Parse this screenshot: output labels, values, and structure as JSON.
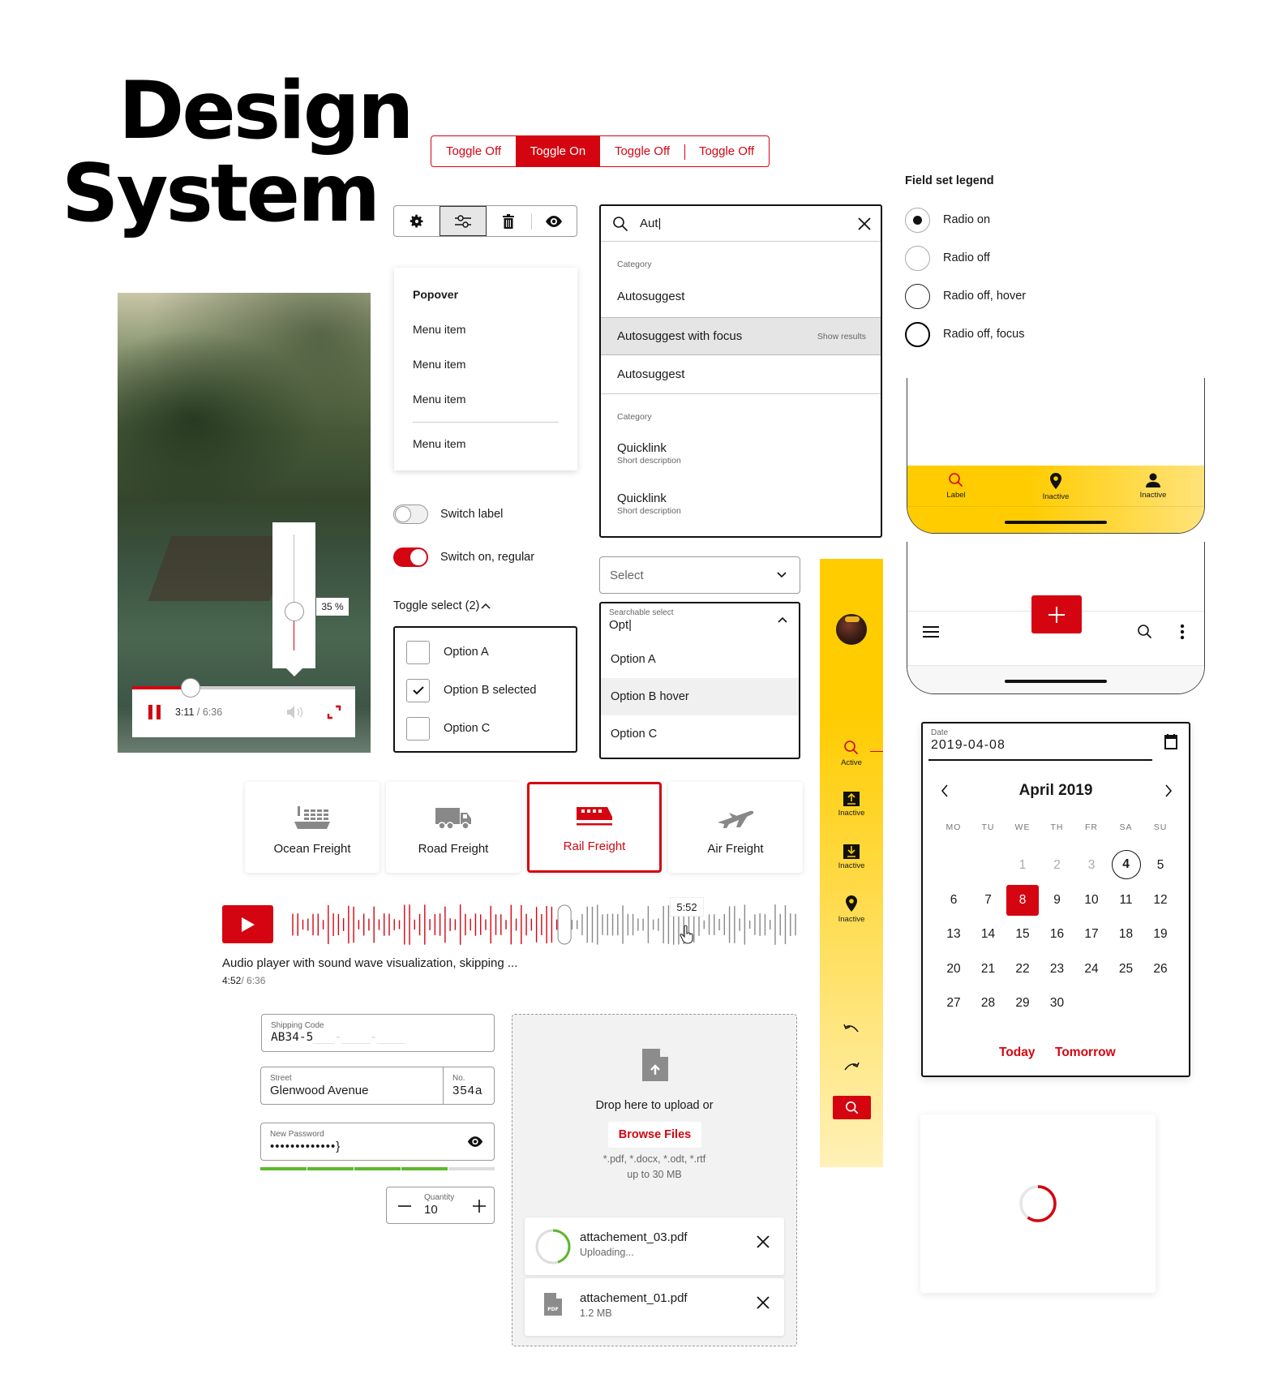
{
  "title": {
    "line1": "Design",
    "line2": "System"
  },
  "toggle_group": [
    {
      "label": "Toggle Off",
      "on": false
    },
    {
      "label": "Toggle On",
      "on": true
    },
    {
      "label": "Toggle Off",
      "on": false
    },
    {
      "label": "Toggle Off",
      "on": false
    }
  ],
  "icon_toolbar": [
    "gear-icon",
    "sliders-icon",
    "trash-icon",
    "eye-icon"
  ],
  "popover": {
    "heading": "Popover",
    "items": [
      "Menu item",
      "Menu item",
      "Menu item",
      "Menu item"
    ]
  },
  "autosuggest": {
    "query": "Aut|",
    "category1": "Category",
    "item1": "Autosuggest",
    "item_focus": "Autosuggest with focus",
    "show_results": "Show results",
    "item3": "Autosuggest",
    "category2": "Category",
    "quicklink1": {
      "title": "Quicklink",
      "desc": "Short description"
    },
    "quicklink2": {
      "title": "Quicklink",
      "desc": "Short description"
    }
  },
  "fieldset": {
    "legend": "Field set legend",
    "radios": [
      {
        "label": "Radio on",
        "checked": true
      },
      {
        "label": "Radio off",
        "checked": false
      },
      {
        "label": "Radio off, hover",
        "checked": false
      },
      {
        "label": "Radio off, focus",
        "checked": false
      }
    ]
  },
  "switches": [
    {
      "label": "Switch label",
      "on": false
    },
    {
      "label": "Switch on, regular",
      "on": true
    }
  ],
  "toggle_select": {
    "label": "Toggle select (2)",
    "options": [
      {
        "label": "Option A",
        "checked": false
      },
      {
        "label": "Option B selected",
        "checked": true
      },
      {
        "label": "Option C",
        "checked": false
      }
    ]
  },
  "select": {
    "placeholder": "Select"
  },
  "searchable_select": {
    "label": "Searchable select",
    "value": "Opt|",
    "options": [
      "Option A",
      "Option B hover",
      "Option C"
    ]
  },
  "video": {
    "volume_percent": 35,
    "volume_label": "35 %",
    "elapsed": "3:11",
    "total": "/ 6:36",
    "progress_fraction": 0.26
  },
  "freight": [
    {
      "label": "Ocean Freight",
      "active": false
    },
    {
      "label": "Road Freight",
      "active": false
    },
    {
      "label": "Rail Freight",
      "active": true
    },
    {
      "label": "Air Freight",
      "active": false
    }
  ],
  "audio": {
    "tooltip": "5:52",
    "caption": "Audio player with sound wave visualization, skipping ...",
    "elapsed": "4:52",
    "total": "/ 6:36",
    "progress_fraction": 0.54
  },
  "side_nav": {
    "items": [
      {
        "label": "Active",
        "icon": "search-icon"
      },
      {
        "label": "Inactive",
        "icon": "upload-icon"
      },
      {
        "label": "Inactive",
        "icon": "download-icon"
      },
      {
        "label": "Inactive",
        "icon": "location-pin-icon"
      }
    ]
  },
  "bottom_tab_bar": {
    "items": [
      {
        "label": "Label",
        "icon": "search-icon"
      },
      {
        "label": "Inactive",
        "icon": "location-pin-icon"
      },
      {
        "label": "Inactive",
        "icon": "user-icon"
      }
    ]
  },
  "datepicker": {
    "label": "Date",
    "value": "2019-04-08",
    "month": "April 2019",
    "weekdays": [
      "MO",
      "TU",
      "WE",
      "TH",
      "FR",
      "SA",
      "SU"
    ],
    "days": [
      "",
      "",
      "1",
      "2",
      "3",
      "4",
      "5",
      "6",
      "7",
      "8",
      "9",
      "10",
      "11",
      "12",
      "13",
      "14",
      "15",
      "16",
      "17",
      "18",
      "19",
      "20",
      "21",
      "22",
      "23",
      "24",
      "25",
      "26",
      "27",
      "28",
      "29",
      "30",
      "",
      "",
      ""
    ],
    "disabled_days": [
      "1",
      "2",
      "3"
    ],
    "today": "4",
    "selected": "8",
    "today_button": "Today",
    "tomorrow_button": "Tomorrow"
  },
  "shipping_code": {
    "label": "Shipping Code",
    "value": "AB34-5",
    "mask": "___-____-____"
  },
  "street": {
    "label": "Street",
    "value": "Glenwood Avenue"
  },
  "house_no": {
    "label": "No.",
    "value": "354a"
  },
  "password": {
    "label": "New Password",
    "value": "•••••••••••••}",
    "strength_fraction": 0.8
  },
  "quantity": {
    "label": "Quantity",
    "value": "10"
  },
  "upload": {
    "drop_text": "Drop here to upload or",
    "browse": "Browse Files",
    "types": "*.pdf, *.docx, *.odt, *.rtf",
    "limit": "up to 30 MB",
    "files": [
      {
        "name": "attachement_03.pdf",
        "status": "Uploading...",
        "progress_fraction": 0.45
      },
      {
        "name": "attachement_01.pdf",
        "status": "1.2 MB"
      }
    ]
  },
  "loader": {
    "progress_fraction": 0.6
  },
  "colors": {
    "brand_red": "#d40511",
    "brand_yellow": "#ffcc00",
    "success_green": "#5cb82c"
  }
}
